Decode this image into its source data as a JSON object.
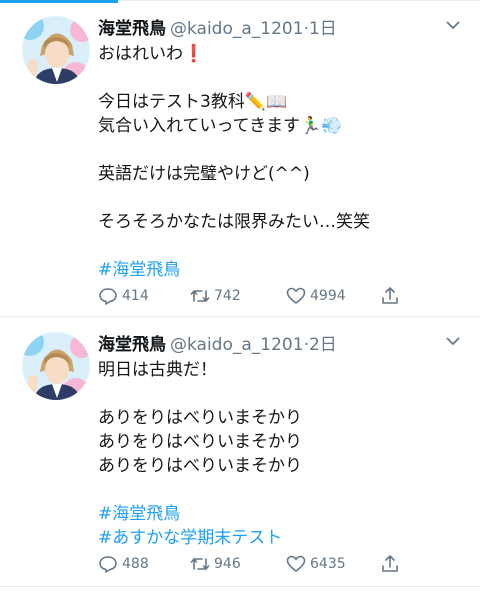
{
  "tweets": [
    {
      "name": "海堂飛鳥",
      "handle": "@kaido_a_1201",
      "separator": "·",
      "time": "1日",
      "lines": [
        "おはれいわ❗",
        "",
        "今日はテスト3教科✏️📖",
        "気合い入れていってきます🏃‍♂️💨",
        "",
        "英語だけは完璧やけど(^^)",
        "",
        "そろそろかなたは限界みたい…笑笑",
        ""
      ],
      "hashtags": [
        "#海堂飛鳥"
      ],
      "replies": "414",
      "retweets": "742",
      "likes": "4994"
    },
    {
      "name": "海堂飛鳥",
      "handle": "@kaido_a_1201",
      "separator": "·",
      "time": "2日",
      "lines": [
        "明日は古典だ！",
        "",
        "ありをりはべりいまそかり",
        "ありをりはべりいまそかり",
        "ありをりはべりいまそかり",
        ""
      ],
      "hashtags": [
        "#海堂飛鳥",
        "#あすかな学期末テスト"
      ],
      "replies": "488",
      "retweets": "946",
      "likes": "6435"
    }
  ],
  "icons": {
    "reply": "reply-icon",
    "retweet": "retweet-icon",
    "like": "heart-icon",
    "share": "share-icon",
    "more": "chevron-down-icon"
  },
  "colors": {
    "link": "#1da1f2",
    "secondary": "#657786",
    "text": "#14171a",
    "divider": "#e6ecf0"
  }
}
